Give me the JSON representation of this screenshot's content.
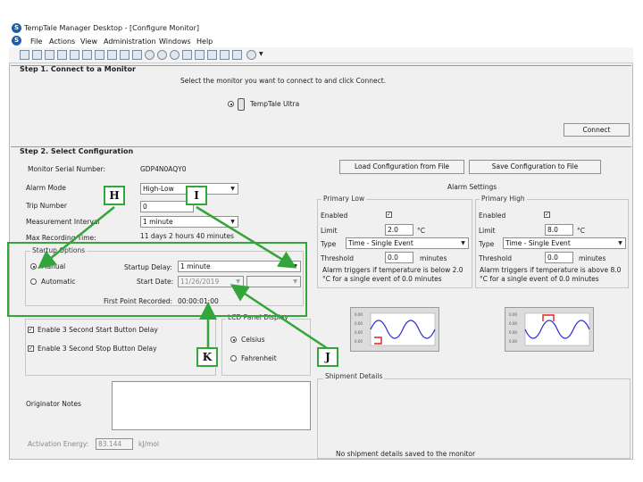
{
  "window": {
    "title": "TempTale Manager Desktop - [Configure Monitor]"
  },
  "menu": [
    "File",
    "Actions",
    "View",
    "Administration",
    "Windows",
    "Help"
  ],
  "step1": {
    "title": "Step 1. Connect to a Monitor",
    "instruction": "Select the monitor you want to connect to and click Connect.",
    "device_option": "TempTale Ultra",
    "connect_label": "Connect"
  },
  "step2": {
    "title": "Step 2. Select Configuration",
    "serial_label": "Monitor Serial Number:",
    "serial_value": "GDP4N0AQY0",
    "load_label": "Load Configuration from File",
    "save_label": "Save Configuration to File",
    "alarm_mode_label": "Alarm Mode",
    "alarm_mode_value": "High-Low",
    "trip_label": "Trip Number",
    "trip_value": "0",
    "interval_label": "Measurement Interval",
    "interval_value": "1 minute",
    "max_label": "Max Recording Time:",
    "max_value": "11 days 2 hours 40 minutes",
    "startup": {
      "legend": "Startup Options",
      "manual": "Manual",
      "automatic": "Automatic",
      "delay_label": "Startup Delay:",
      "delay_value": "1 minute",
      "date_label": "Start Date:",
      "date_value": "11/26/2019",
      "first_label": "First Point Recorded:",
      "first_value": "00:00:01:00"
    },
    "start_delay_label": "Enable 3 Second Start Button Delay",
    "stop_delay_label": "Enable 3 Second Stop Button Delay",
    "lcd_legend": "LCD Panel Display",
    "celsius": "Celsius",
    "fahrenheit": "Fahrenheit",
    "originator_label": "Originator Notes",
    "activation_label": "Activation Energy:",
    "activation_value": "83.144",
    "activation_unit": "kJ/mol"
  },
  "alarm": {
    "title": "Alarm Settings",
    "low": {
      "legend": "Primary Low",
      "enabled_label": "Enabled",
      "limit_label": "Limit",
      "limit_value": "2.0",
      "unit": "°C",
      "type_label": "Type",
      "type_value": "Time - Single Event",
      "threshold_label": "Threshold",
      "threshold_value": "0.0",
      "minutes": "minutes",
      "desc": "Alarm triggers if temperature is below 2.0 °C for a single event of 0.0 minutes"
    },
    "high": {
      "legend": "Primary High",
      "enabled_label": "Enabled",
      "limit_label": "Limit",
      "limit_value": "8.0",
      "unit": "°C",
      "type_label": "Type",
      "type_value": "Time - Single Event",
      "threshold_label": "Threshold",
      "threshold_value": "0.0",
      "minutes": "minutes",
      "desc": "Alarm triggers if temperature is above 8.0 °C for a single event of 0.0 minutes"
    }
  },
  "shipment": {
    "legend": "Shipment Details",
    "empty": "No shipment details saved to the monitor"
  },
  "callouts": {
    "h": "H",
    "i": "I",
    "j": "J",
    "k": "K"
  },
  "colors": {
    "highlight": "#33a53a",
    "graph_wave": "#2b2bd6",
    "graph_alarm": "#e0201c"
  }
}
